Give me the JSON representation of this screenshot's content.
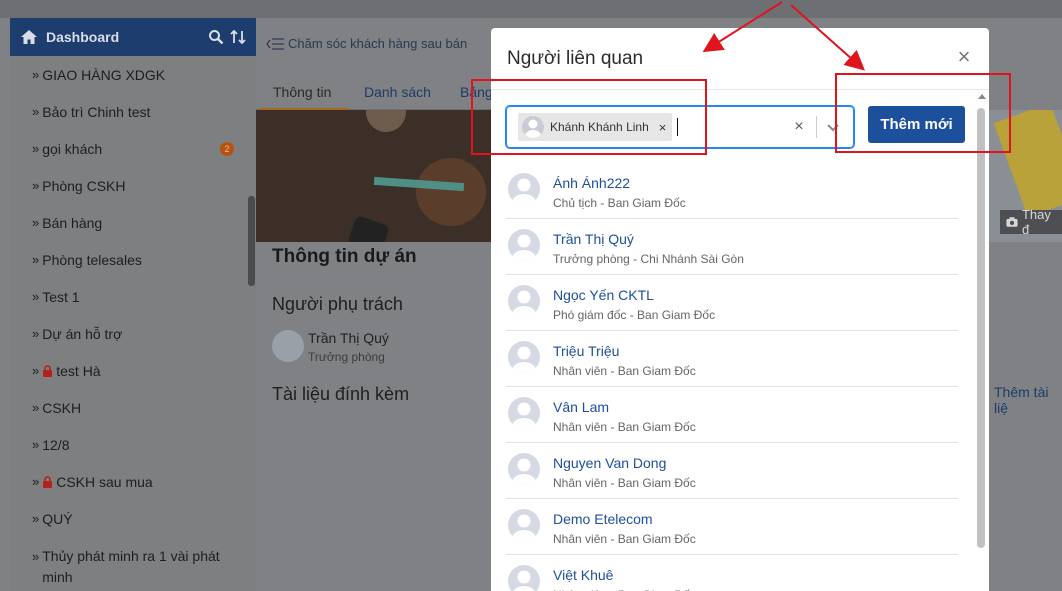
{
  "sidebar": {
    "title": "Dashboard",
    "items": [
      {
        "label": "GIAO HÀNG XDGK",
        "lock": false,
        "badge": ""
      },
      {
        "label": "Bảo trì Chinh test",
        "lock": false,
        "badge": ""
      },
      {
        "label": "gọi khách",
        "lock": false,
        "badge": "2"
      },
      {
        "label": "Phòng CSKH",
        "lock": false,
        "badge": ""
      },
      {
        "label": "Bán hàng",
        "lock": false,
        "badge": ""
      },
      {
        "label": "Phòng telesales",
        "lock": false,
        "badge": ""
      },
      {
        "label": "Test 1",
        "lock": false,
        "badge": ""
      },
      {
        "label": "Dự án hỗ trợ",
        "lock": false,
        "badge": ""
      },
      {
        "label": "test Hà",
        "lock": true,
        "badge": ""
      },
      {
        "label": "CSKH",
        "lock": false,
        "badge": ""
      },
      {
        "label": "12/8",
        "lock": false,
        "badge": ""
      },
      {
        "label": "CSKH sau mua",
        "lock": true,
        "badge": ""
      },
      {
        "label": "QUÝ",
        "lock": false,
        "badge": ""
      },
      {
        "label": "Thủy phát minh ra 1 vài phát minh",
        "lock": false,
        "badge": ""
      }
    ]
  },
  "main": {
    "back_label": "Chăm sóc khách hàng sau bán",
    "tabs": [
      "Thông tin",
      "Danh sách",
      "Bảng"
    ],
    "section_title": "Thông tin dự án",
    "person_heading": "Người phụ trách",
    "person_name": "Trần Thị Quý",
    "person_role": "Trưởng phòng",
    "docs_heading": "Tài liệu đính kèm",
    "change_photo": "Thay đ",
    "add_doc": "Thêm tài liệ"
  },
  "modal": {
    "title": "Người liên quan",
    "close": "×",
    "selected_chip": "Khánh Khánh Linh",
    "chip_remove": "×",
    "clear": "×",
    "add_button": "Thêm mới",
    "people": [
      {
        "name": "Ánh Ánh222",
        "role": "Chủ tịch - Ban Giam Đốc"
      },
      {
        "name": "Trần Thị Quý",
        "role": "Trưởng phòng - Chi Nhánh Sài Gòn"
      },
      {
        "name": "Ngọc Yến CKTL",
        "role": "Phó giám đốc - Ban Giam Đốc"
      },
      {
        "name": "Triệu Triệu",
        "role": "Nhân viên - Ban Giam Đốc"
      },
      {
        "name": "Vân Lam",
        "role": "Nhân viên - Ban Giam Đốc"
      },
      {
        "name": "Nguyen Van Dong",
        "role": "Nhân viên - Ban Giam Đốc"
      },
      {
        "name": "Demo Etelecom",
        "role": "Nhân viên - Ban Giam Đốc"
      },
      {
        "name": "Việt Khuê",
        "role": "Nhân viên - Ban Giam Đốc"
      }
    ]
  },
  "colors": {
    "primary": "#1c4f9c",
    "annotation": "#e0141c",
    "focus": "#2684ff",
    "badge": "#b8520f"
  }
}
